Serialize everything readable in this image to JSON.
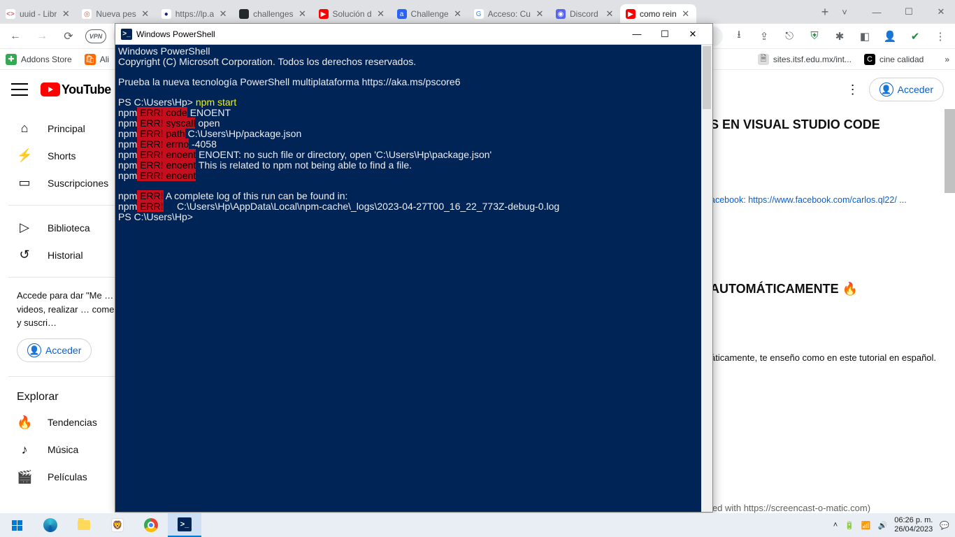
{
  "chrome": {
    "tabs": [
      {
        "label": "uuid - Libr",
        "fav": "<>",
        "favbg": "#fff",
        "favcolor": "#cb3837"
      },
      {
        "label": "Nueva pes",
        "fav": "◎",
        "favbg": "#fff",
        "favcolor": "#fb542b"
      },
      {
        "label": "https://lp.a",
        "fav": "●",
        "favbg": "#fff",
        "favcolor": "#1a237e"
      },
      {
        "label": "challenges",
        "fav": "",
        "favbg": "#24292e",
        "favcolor": "#fff"
      },
      {
        "label": "Solución d",
        "fav": "▶",
        "favbg": "#ff0000",
        "favcolor": "#fff"
      },
      {
        "label": "Challenge",
        "fav": "a",
        "favbg": "#2962ff",
        "favcolor": "#fff"
      },
      {
        "label": "Acceso: Cu",
        "fav": "G",
        "favbg": "#fff",
        "favcolor": "#4285f4"
      },
      {
        "label": "Discord",
        "fav": "◉",
        "favbg": "#5865f2",
        "favcolor": "#fff"
      },
      {
        "label": "como rein",
        "fav": "▶",
        "favbg": "#ff0000",
        "favcolor": "#fff",
        "active": true
      }
    ],
    "vpn": "VPN",
    "bookmarks": [
      {
        "label": "Addons Store",
        "ibg": "#34a853",
        "icolor": "#fff",
        "glyph": "✚"
      },
      {
        "label": "Ali",
        "ibg": "#ff6a00",
        "icolor": "#fff",
        "glyph": "🛍"
      },
      {
        "label": "sites.itsf.edu.mx/int...",
        "ibg": "#ddd",
        "icolor": "#555",
        "glyph": "🗎"
      },
      {
        "label": "cine calidad",
        "ibg": "#000",
        "icolor": "#fff",
        "glyph": "C"
      }
    ],
    "more": "»"
  },
  "yt": {
    "logo": "YouTube",
    "access": "Acceder",
    "sidebar": {
      "items": [
        {
          "icon": "⌂",
          "label": "Principal"
        },
        {
          "icon": "⚡",
          "label": "Shorts"
        },
        {
          "icon": "▭",
          "label": "Suscripciones"
        }
      ],
      "library": [
        {
          "icon": "▷",
          "label": "Biblioteca"
        },
        {
          "icon": "↺",
          "label": "Historial"
        }
      ],
      "promo": "Accede para dar \"Me … a los videos, realizar … comentarios y suscri…",
      "explore_head": "Explorar",
      "explore": [
        {
          "icon": "🔥",
          "label": "Tendencias"
        },
        {
          "icon": "♪",
          "label": "Música"
        },
        {
          "icon": "🎬",
          "label": "Películas"
        }
      ]
    },
    "content": {
      "h1_frag": "S EN VISUAL STUDIO CODE",
      "fb_frag": "acebook: https://www.facebook.com/carlos.ql22/ ...",
      "h2_frag": "AUTOMÁTICAMENTE 🔥",
      "desc_frag": "áticamente, te enseño como en este tutorial en español.",
      "rec_frag": "led with https://screencast-o-matic.com)"
    }
  },
  "powershell": {
    "title": "Windows PowerShell",
    "lines": {
      "l1": "Windows PowerShell",
      "l2": "Copyright (C) Microsoft Corporation. Todos los derechos reservados.",
      "l3": "Prueba la nueva tecnología PowerShell multiplataforma https://aka.ms/pscore6",
      "prompt1a": "PS C:\\Users\\Hp> ",
      "prompt1b": "npm start",
      "npm": "npm",
      "err": " ERR!",
      "e_code": " code",
      "e_sys": " syscall",
      "e_path": " path",
      "e_errno": " errno",
      "e_enoent": " enoent",
      "v_code": " ENOENT",
      "v_sys": " open",
      "v_path": " C:\\Users\\Hp/package.json",
      "v_errno": " -4058",
      "v_en1": " ENOENT: no such file or directory, open 'C:\\Users\\Hp\\package.json'",
      "v_en2": " This is related to npm not being able to find a file.",
      "v_en3": "",
      "log1": " A complete log of this run can be found in:",
      "log2": "     C:\\Users\\Hp\\AppData\\Local\\npm-cache\\_logs\\2023-04-27T00_16_22_773Z-debug-0.log",
      "prompt2": "PS C:\\Users\\Hp>"
    }
  },
  "taskbar": {
    "time": "06:26 p. m.",
    "date": "26/04/2023"
  }
}
